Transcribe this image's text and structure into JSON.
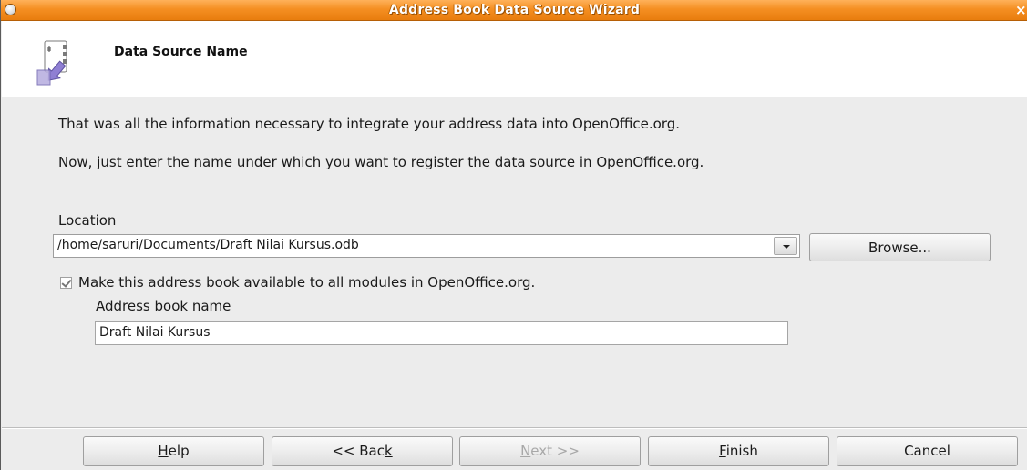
{
  "window": {
    "title": "Address Book Data Source Wizard",
    "close_glyph": "×"
  },
  "header": {
    "title": "Data Source Name",
    "icon": "address-book-import-icon"
  },
  "body": {
    "line1": "That was all the information necessary to integrate your address data into OpenOffice.org.",
    "line2": "Now, just enter the name under which you want to register the data source in OpenOffice.org."
  },
  "location": {
    "label": "Location",
    "value": "/home/saruri/Documents/Draft Nilai Kursus.odb",
    "browse_label": "Browse..."
  },
  "availability": {
    "checked": true,
    "label": "Make this address book available to all modules in OpenOffice.org."
  },
  "address_book_name": {
    "label": "Address book name",
    "value": "Draft Nilai Kursus"
  },
  "buttons": {
    "help": {
      "label": "Help",
      "mnemonic": "H",
      "rest": "elp"
    },
    "back": {
      "label": "<< Back",
      "prefix": "<< Bac",
      "mnemonic": "k"
    },
    "next": {
      "label": "Next >>",
      "mnemonic": "N",
      "rest": "ext >>",
      "enabled": false
    },
    "finish": {
      "label": "Finish",
      "mnemonic": "F",
      "rest": "inish"
    },
    "cancel": {
      "label": "Cancel"
    }
  },
  "colors": {
    "titlebar": "#f58f22",
    "dialog_bg": "#ececec",
    "header_bg": "#ffffff",
    "accent_icon": "#8f7fd3"
  }
}
